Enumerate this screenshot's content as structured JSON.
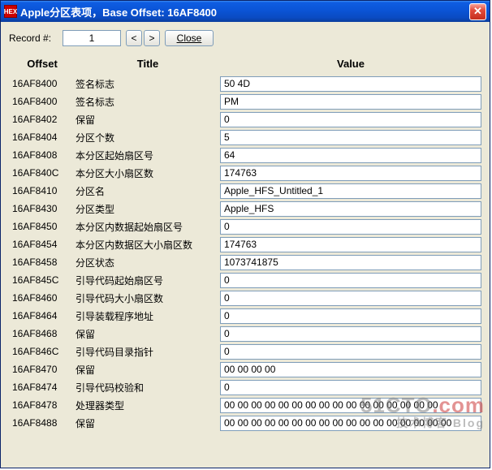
{
  "window": {
    "title": "Apple分区表项，Base Offset: 16AF8400",
    "app_icon_text": "HEX"
  },
  "toolbar": {
    "record_label": "Record #:",
    "record_value": "1",
    "prev_label": "<",
    "next_label": ">",
    "close_label": "Close"
  },
  "headers": {
    "offset": "Offset",
    "title": "Title",
    "value": "Value"
  },
  "rows": [
    {
      "offset": "16AF8400",
      "title": "签名标志",
      "value": "50 4D"
    },
    {
      "offset": "16AF8400",
      "title": "签名标志",
      "value": "PM"
    },
    {
      "offset": "16AF8402",
      "title": "保留",
      "value": "0"
    },
    {
      "offset": "16AF8404",
      "title": "分区个数",
      "value": "5"
    },
    {
      "offset": "16AF8408",
      "title": "本分区起始扇区号",
      "value": "64"
    },
    {
      "offset": "16AF840C",
      "title": "本分区大小扇区数",
      "value": "174763"
    },
    {
      "offset": "16AF8410",
      "title": "分区名",
      "value": "Apple_HFS_Untitled_1"
    },
    {
      "offset": "16AF8430",
      "title": "分区类型",
      "value": "Apple_HFS"
    },
    {
      "offset": "16AF8450",
      "title": "本分区内数据起始扇区号",
      "value": "0"
    },
    {
      "offset": "16AF8454",
      "title": "本分区内数据区大小扇区数",
      "value": "174763"
    },
    {
      "offset": "16AF8458",
      "title": "分区状态",
      "value": "1073741875"
    },
    {
      "offset": "16AF845C",
      "title": "引导代码起始扇区号",
      "value": "0"
    },
    {
      "offset": "16AF8460",
      "title": "引导代码大小扇区数",
      "value": "0"
    },
    {
      "offset": "16AF8464",
      "title": "引导装载程序地址",
      "value": "0"
    },
    {
      "offset": "16AF8468",
      "title": "保留",
      "value": "0"
    },
    {
      "offset": "16AF846C",
      "title": "引导代码目录指针",
      "value": "0"
    },
    {
      "offset": "16AF8470",
      "title": "保留",
      "value": "00 00 00 00"
    },
    {
      "offset": "16AF8474",
      "title": "引导代码校验和",
      "value": "0"
    },
    {
      "offset": "16AF8478",
      "title": "处理器类型",
      "value": "00 00 00 00 00 00 00 00 00 00 00 00 00 00 00 00"
    },
    {
      "offset": "16AF8488",
      "title": "保留",
      "value": "00 00 00 00 00 00 00 00 00 00 00 00 00 00 00 00 00"
    }
  ],
  "watermark": {
    "line1_a": "51CTO",
    "line1_b": ".com",
    "line2": "技术博客   Blog"
  }
}
